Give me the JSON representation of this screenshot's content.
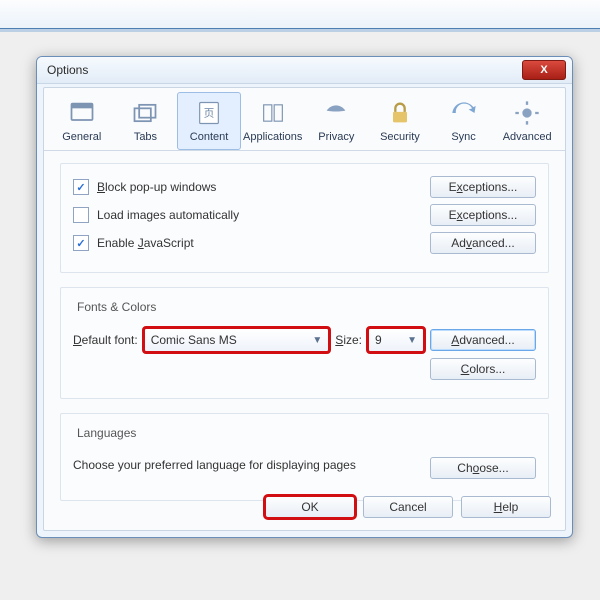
{
  "window": {
    "title": "Options",
    "close": "X"
  },
  "tabs": [
    {
      "label": "General"
    },
    {
      "label": "Tabs"
    },
    {
      "label": "Content"
    },
    {
      "label": "Applications"
    },
    {
      "label": "Privacy"
    },
    {
      "label": "Security"
    },
    {
      "label": "Sync"
    },
    {
      "label": "Advanced"
    }
  ],
  "content": {
    "popup_label": "Block pop-up windows",
    "images_label": "Load images automatically",
    "js_label": "Enable JavaScript",
    "exceptions_label": "Exceptions...",
    "advanced_label": "Advanced..."
  },
  "fonts": {
    "group_title": "Fonts & Colors",
    "default_font_label": "Default font:",
    "default_font_value": "Comic Sans MS",
    "size_label": "Size:",
    "size_value": "9",
    "advanced_label": "Advanced...",
    "colors_label": "Colors..."
  },
  "lang": {
    "group_title": "Languages",
    "desc": "Choose your preferred language for displaying pages",
    "choose_label": "Choose..."
  },
  "buttons": {
    "ok": "OK",
    "cancel": "Cancel",
    "help": "Help"
  }
}
